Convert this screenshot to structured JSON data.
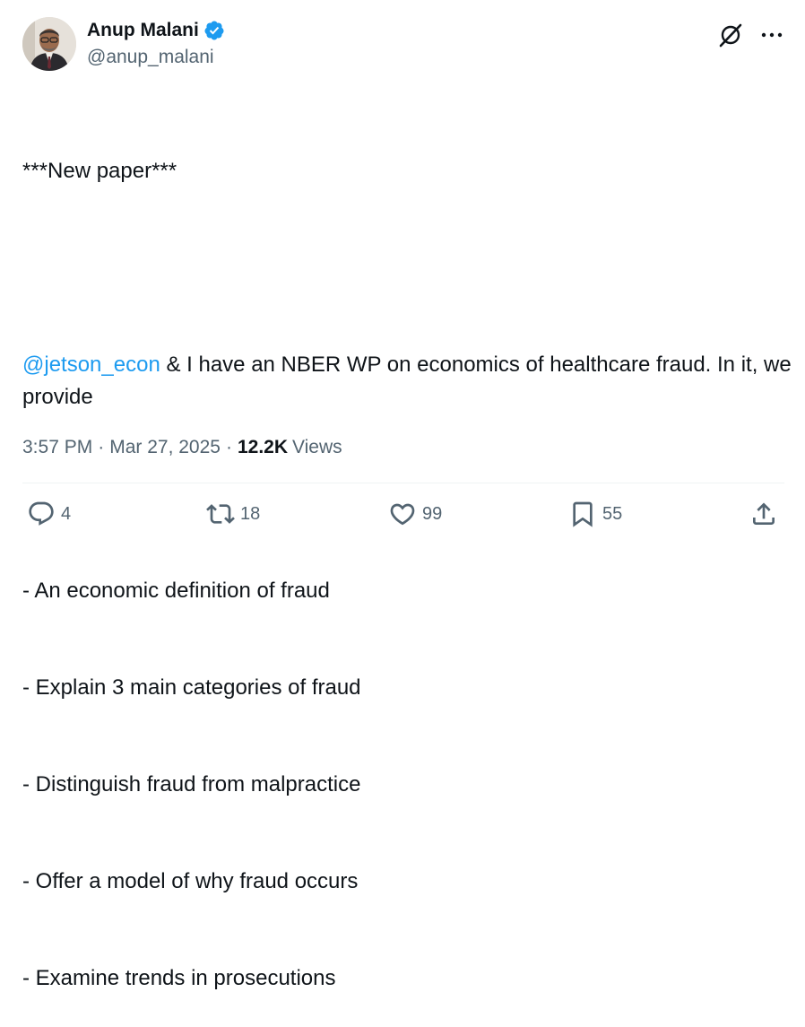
{
  "author": {
    "display_name": "Anup Malani",
    "handle": "@anup_malani",
    "verified": true,
    "verified_color": "#1d9bf0"
  },
  "tweet": {
    "line1": "***New paper***",
    "mention": "@jetson_econ",
    "line2_rest": " & I have an NBER WP on economics of healthcare fraud. In it, we provide",
    "bullets": [
      "- An economic definition of fraud",
      "- Explain 3 main categories of fraud",
      "- Distinguish fraud from malpractice",
      "- Offer a model of why fraud occurs",
      "- Examine trends in prosecutions"
    ]
  },
  "meta": {
    "time": "3:57 PM",
    "separator": "·",
    "date": "Mar 27, 2025",
    "views_count": "12.2K",
    "views_label": "Views"
  },
  "actions": {
    "replies": "4",
    "reposts": "18",
    "likes": "99",
    "bookmarks": "55"
  },
  "icons": {
    "grok": "grok-icon",
    "more": "more-icon",
    "reply": "reply-icon",
    "repost": "repost-icon",
    "like": "heart-icon",
    "bookmark": "bookmark-icon",
    "share": "share-icon"
  },
  "colors": {
    "text": "#0f1419",
    "secondary": "#536471",
    "link": "#1d9bf0"
  }
}
